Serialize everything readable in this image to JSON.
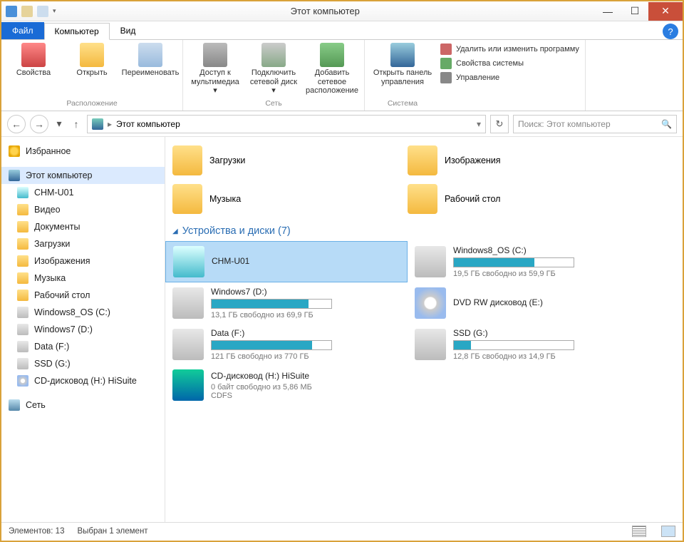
{
  "window": {
    "title": "Этот компьютер"
  },
  "tabs": {
    "file": "Файл",
    "computer": "Компьютер",
    "view": "Вид"
  },
  "ribbon": {
    "group_location": "Расположение",
    "group_network": "Сеть",
    "group_system": "Система",
    "props": "Свойства",
    "open": "Открыть",
    "rename": "Переименовать",
    "media": "Доступ к мультимедиа ▾",
    "netdrive": "Подключить сетевой диск ▾",
    "addnet": "Добавить сетевое расположение",
    "cp": "Открыть панель управления",
    "uninstall": "Удалить или изменить программу",
    "sysprops": "Свойства системы",
    "manage": "Управление"
  },
  "nav": {
    "path": "Этот компьютер",
    "search_placeholder": "Поиск: Этот компьютер"
  },
  "sidebar": {
    "fav": "Избранное",
    "pc": "Этот компьютер",
    "items": [
      "CHM-U01",
      "Видео",
      "Документы",
      "Загрузки",
      "Изображения",
      "Музыка",
      "Рабочий стол",
      "Windows8_OS (C:)",
      "Windows7 (D:)",
      "Data (F:)",
      "SSD (G:)",
      "CD-дисковод (H:) HiSuite"
    ],
    "net": "Сеть"
  },
  "folders": {
    "downloads": "Загрузки",
    "pictures": "Изображения",
    "music": "Музыка",
    "desktop": "Рабочий стол"
  },
  "devices": {
    "header": "Устройства и диски (7)",
    "chm": "CHM-U01",
    "c": {
      "name": "Windows8_OS (C:)",
      "free": "19,5 ГБ свободно из 59,9 ГБ",
      "pct": 67
    },
    "d": {
      "name": "Windows7 (D:)",
      "free": "13,1 ГБ свободно из 69,9 ГБ",
      "pct": 81
    },
    "dvd": {
      "name": "DVD RW дисковод (E:)"
    },
    "f": {
      "name": "Data (F:)",
      "free": "121 ГБ свободно из 770 ГБ",
      "pct": 84
    },
    "g": {
      "name": "SSD (G:)",
      "free": "12,8 ГБ свободно из 14,9 ГБ",
      "pct": 14
    },
    "h": {
      "name": "CD-дисковод (H:) HiSuite",
      "free": "0 байт свободно из 5,86 МБ",
      "fs": "CDFS"
    }
  },
  "status": {
    "count": "Элементов: 13",
    "sel": "Выбран 1 элемент"
  }
}
